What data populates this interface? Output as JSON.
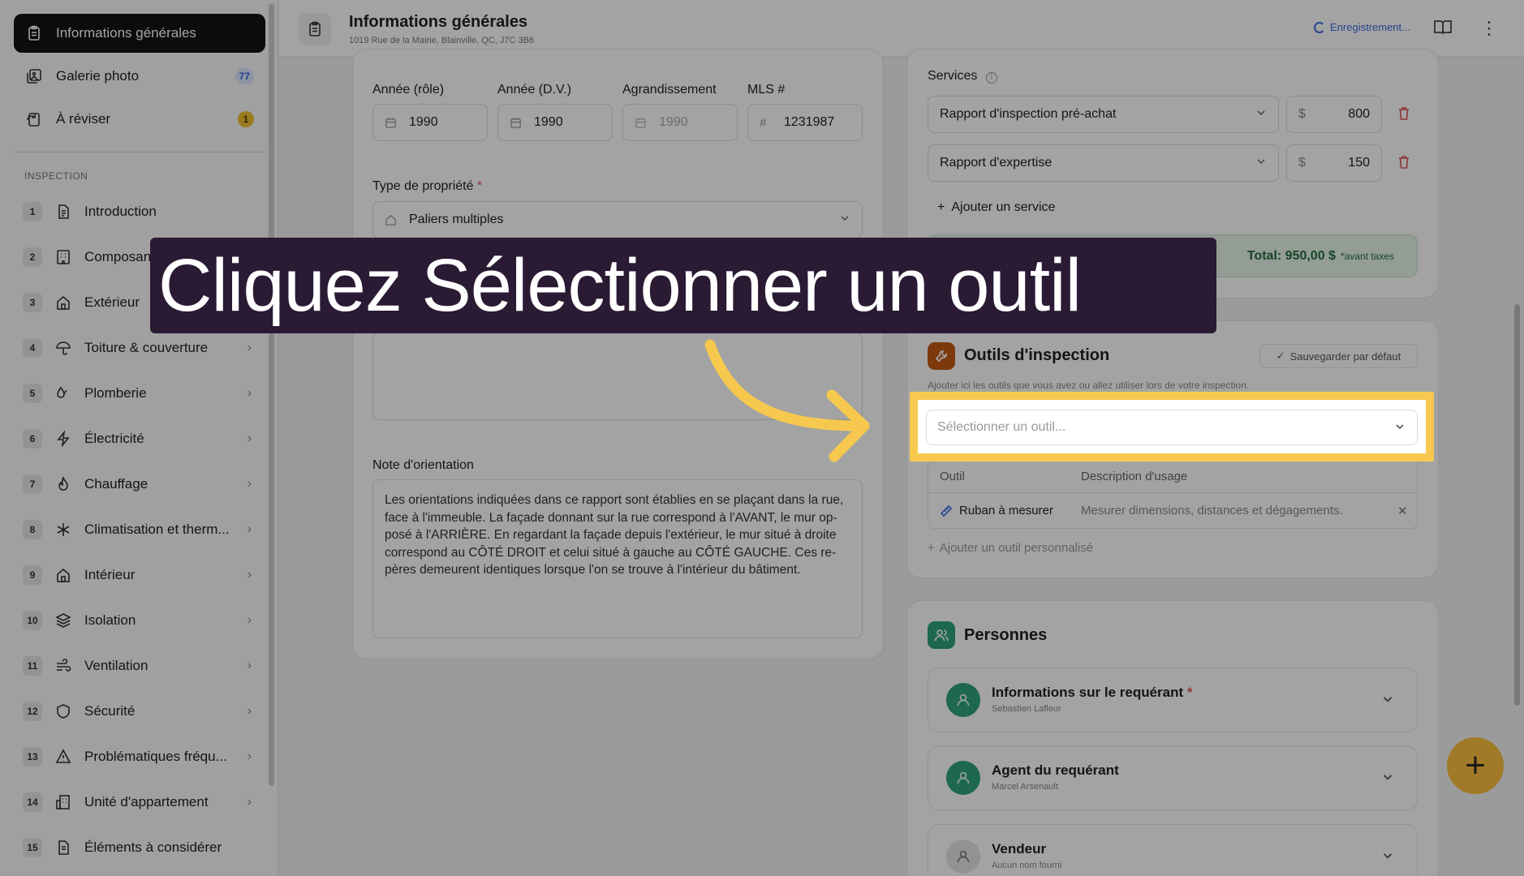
{
  "sidebar": {
    "top_items": [
      {
        "label": "Informations générales",
        "badge": ""
      },
      {
        "label": "Galerie photo",
        "badge": "77"
      },
      {
        "label": "À réviser",
        "badge": "1"
      }
    ],
    "section_label": "INSPECTION",
    "items": [
      {
        "num": "1",
        "label": "Introduction"
      },
      {
        "num": "2",
        "label": "Composan"
      },
      {
        "num": "3",
        "label": "Extérieur"
      },
      {
        "num": "4",
        "label": "Toiture & couverture"
      },
      {
        "num": "5",
        "label": "Plomberie"
      },
      {
        "num": "6",
        "label": "Électricité"
      },
      {
        "num": "7",
        "label": "Chauffage"
      },
      {
        "num": "8",
        "label": "Climatisation et therm..."
      },
      {
        "num": "9",
        "label": "Intérieur"
      },
      {
        "num": "10",
        "label": "Isolation"
      },
      {
        "num": "11",
        "label": "Ventilation"
      },
      {
        "num": "12",
        "label": "Sécurité"
      },
      {
        "num": "13",
        "label": "Problématiques fréqu..."
      },
      {
        "num": "14",
        "label": "Unité d'appartement"
      },
      {
        "num": "15",
        "label": "Éléments à considérer"
      }
    ]
  },
  "header": {
    "title": "Informations générales",
    "address": "1019 Rue de la Mairie, Blainville, QC, J7C 3B6",
    "status": "Enregistrement..."
  },
  "property": {
    "year_role_label": "Année (rôle)",
    "year_role_value": "1990",
    "year_dv_label": "Année (D.V.)",
    "year_dv_value": "1990",
    "extension_label": "Agrandissement",
    "extension_placeholder": "1990",
    "mls_label": "MLS #",
    "mls_value": "1231987",
    "type_label": "Type de propriété",
    "type_value": "Paliers multiples",
    "orientation_label": "Note d'orientation",
    "orientation_text": "Les orientations indiquées dans ce rapport sont établies en se plaçant dans la rue, face à l'immeuble. La façade donnant sur la rue correspond à l'AVANT, le mur op-posé à l'ARRIÈRE. En regardant la façade depuis l'extérieur, le mur situé à droite correspond au CÔTÉ DROIT et celui situé à gauche au CÔTÉ GAUCHE. Ces re-pères demeurent identiques lorsque l'on se trouve à l'intérieur du bâtiment."
  },
  "services": {
    "label": "Services",
    "items": [
      {
        "name": "Rapport d'inspection pré-achat",
        "currency": "$",
        "price": "800"
      },
      {
        "name": "Rapport d'expertise",
        "currency": "$",
        "price": "150"
      }
    ],
    "add_label": "Ajouter un service",
    "total": "Total: 950,00 $",
    "total_note": "*avant taxes"
  },
  "tools": {
    "title": "Outils d'inspection",
    "save_default": "Sauvegarder par défaut",
    "description": "Ajouter ici les outils que vous avez ou allez utiliser lors de votre inspection.",
    "select_placeholder": "Sélectionner un outil...",
    "col_tool": "Outil",
    "col_desc": "Description d'usage",
    "rows": [
      {
        "tool": "Ruban à mesurer",
        "desc": "Mesurer dimensions, distances et dégagements."
      }
    ],
    "add_custom": "Ajouter un outil personnalisé"
  },
  "persons": {
    "title": "Personnes",
    "items": [
      {
        "name": "Informations sur le requérant",
        "sub": "Sebastien Lafleur",
        "required": "*"
      },
      {
        "name": "Agent du requérant",
        "sub": "Marcel Arsenault",
        "required": ""
      },
      {
        "name": "Vendeur",
        "sub": "Aucun nom fourni",
        "required": ""
      }
    ]
  },
  "overlay": {
    "instruction": "Cliquez Sélectionner un outil"
  },
  "colors": {
    "highlight": "#f6c94e",
    "banner_bg": "#2a1a33",
    "accent_blue": "#3a6ce0",
    "total_green": "#246b3b",
    "danger": "#e05555"
  }
}
